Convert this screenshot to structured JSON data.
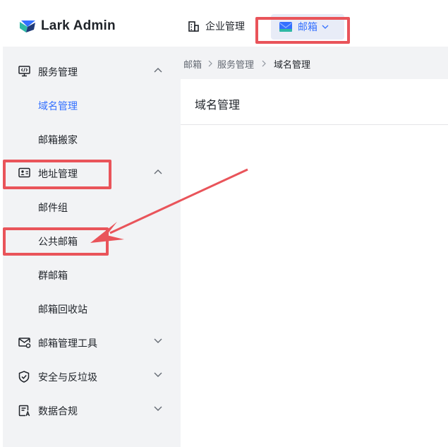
{
  "header": {
    "brand": "Lark Admin",
    "nav": [
      {
        "label": "企业管理"
      },
      {
        "label": "邮箱"
      }
    ]
  },
  "sidebar": {
    "groups": [
      {
        "label": "服务管理",
        "icon": "monitor-code-icon",
        "expanded": true,
        "items": [
          {
            "label": "域名管理",
            "active": true
          },
          {
            "label": "邮箱搬家"
          }
        ]
      },
      {
        "label": "地址管理",
        "icon": "contact-card-icon",
        "expanded": true,
        "items": [
          {
            "label": "邮件组"
          },
          {
            "label": "公共邮箱"
          },
          {
            "label": "群邮箱"
          },
          {
            "label": "邮箱回收站"
          }
        ]
      },
      {
        "label": "邮箱管理工具",
        "icon": "mail-settings-icon",
        "expanded": false
      },
      {
        "label": "安全与反垃圾",
        "icon": "shield-check-icon",
        "expanded": false
      },
      {
        "label": "数据合规",
        "icon": "data-doc-icon",
        "expanded": false
      }
    ]
  },
  "breadcrumb": [
    "邮箱",
    "服务管理",
    "域名管理"
  ],
  "main": {
    "title": "域名管理"
  },
  "colors": {
    "accent": "#3370ff",
    "annotation": "#e9545a",
    "sidebar_bg": "#f2f3f5"
  }
}
